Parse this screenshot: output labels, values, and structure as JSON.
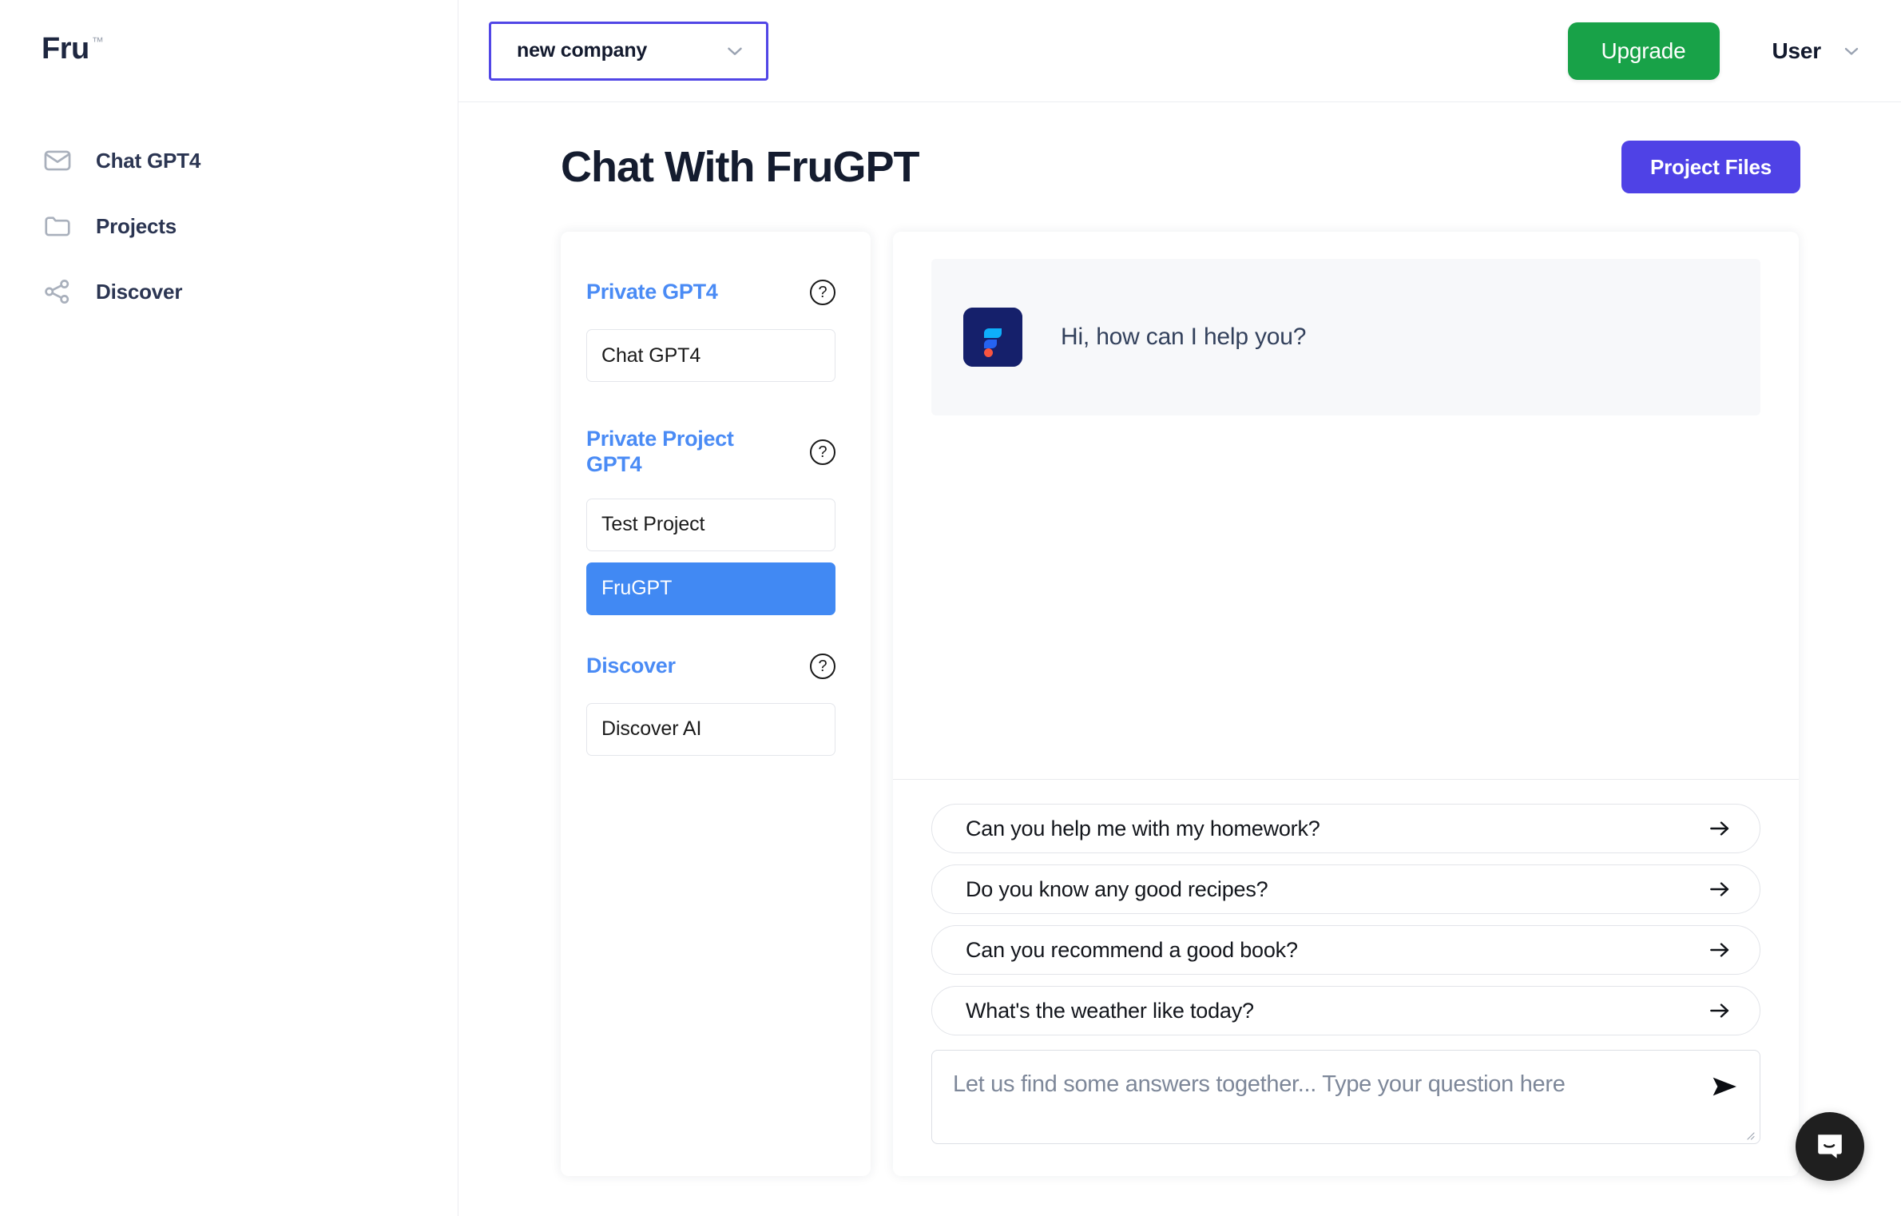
{
  "brand": {
    "name": "Fru",
    "tm": "™"
  },
  "sidebar": {
    "items": [
      {
        "label": "Chat GPT4",
        "icon": "mail-icon"
      },
      {
        "label": "Projects",
        "icon": "folder-icon"
      },
      {
        "label": "Discover",
        "icon": "share-icon"
      }
    ]
  },
  "topbar": {
    "company": "new company",
    "company_chevron": "chevron-down-icon",
    "upgrade_label": "Upgrade",
    "user_label": "User",
    "user_chevron": "chevron-down-icon"
  },
  "page": {
    "title": "Chat With FruGPT",
    "project_files_label": "Project Files"
  },
  "side_panel": {
    "groups": [
      {
        "title": "Private GPT4",
        "help": "?",
        "options": [
          {
            "label": "Chat GPT4",
            "selected": false
          }
        ]
      },
      {
        "title": "Private Project GPT4",
        "help": "?",
        "options": [
          {
            "label": "Test Project",
            "selected": false
          },
          {
            "label": "FruGPT",
            "selected": true
          }
        ]
      },
      {
        "title": "Discover",
        "help": "?",
        "options": [
          {
            "label": "Discover AI",
            "selected": false
          }
        ]
      }
    ]
  },
  "chat": {
    "bot_avatar": "frugpt-logo-icon",
    "bot_message": "Hi, how can I help you?",
    "suggestions": [
      "Can you help me with my homework?",
      "Do you know any good recipes?",
      "Can you recommend a good book?",
      "What's the weather like today?"
    ],
    "composer_placeholder": "Let us find some answers together... Type your question here",
    "send_icon": "send-icon"
  },
  "launcher": {
    "icon": "chat-bubble-icon"
  },
  "colors": {
    "accent_indigo": "#4f42e6",
    "accent_blue": "#4189f3",
    "heading_blue": "#4a8bf5",
    "upgrade_green": "#18a248",
    "logo_navy": "#15206b",
    "logo_cyan": "#0eaffb",
    "logo_blue": "#2563f0",
    "logo_red": "#f9543f",
    "text_dark": "#141c2f"
  }
}
